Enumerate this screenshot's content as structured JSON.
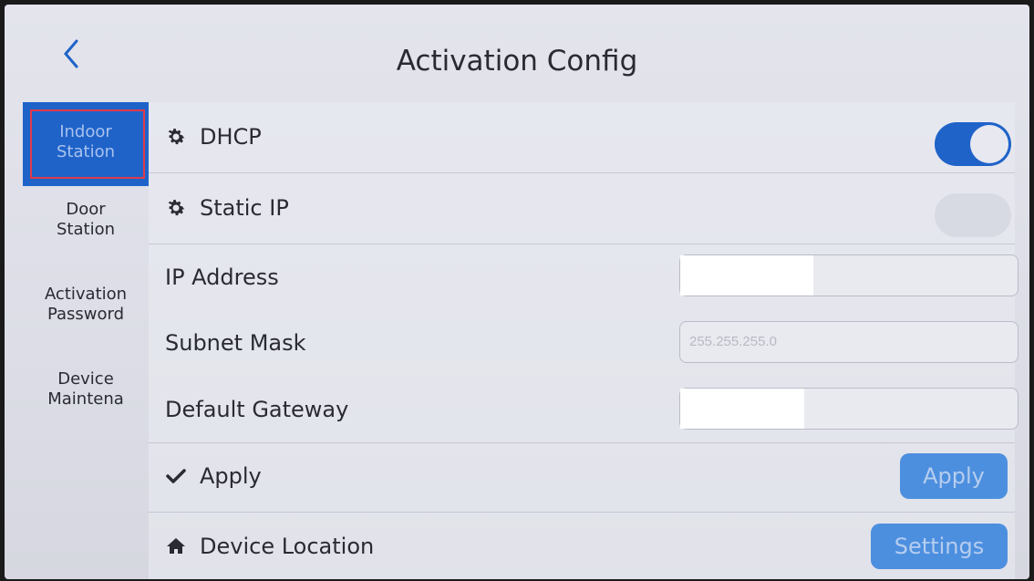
{
  "header": {
    "title": "Activation Config",
    "back_icon": "chevron-left-icon"
  },
  "sidebar": {
    "items": [
      {
        "label": "Indoor\nStation",
        "active": true
      },
      {
        "label": "Door\nStation",
        "active": false
      },
      {
        "label": "Activation\nPassword",
        "active": false
      },
      {
        "label": "Device\nMaintena",
        "active": false
      }
    ]
  },
  "main": {
    "dhcp": {
      "label": "DHCP",
      "icon": "gear-icon",
      "enabled": true
    },
    "static_ip": {
      "label": "Static IP",
      "icon": "gear-icon",
      "enabled": false
    },
    "ip_address": {
      "label": "IP Address",
      "value": ""
    },
    "subnet_mask": {
      "label": "Subnet Mask",
      "placeholder": "255.255.255.0"
    },
    "default_gateway": {
      "label": "Default Gateway",
      "value": ""
    },
    "apply": {
      "label": "Apply",
      "icon": "checkmark-icon",
      "button_label": "Apply"
    },
    "device_location": {
      "label": "Device Location",
      "icon": "home-icon",
      "button_label": "Settings"
    }
  },
  "colors": {
    "accent": "#1f63c9",
    "button": "#4d8fdf",
    "highlight": "#e03a4a"
  }
}
